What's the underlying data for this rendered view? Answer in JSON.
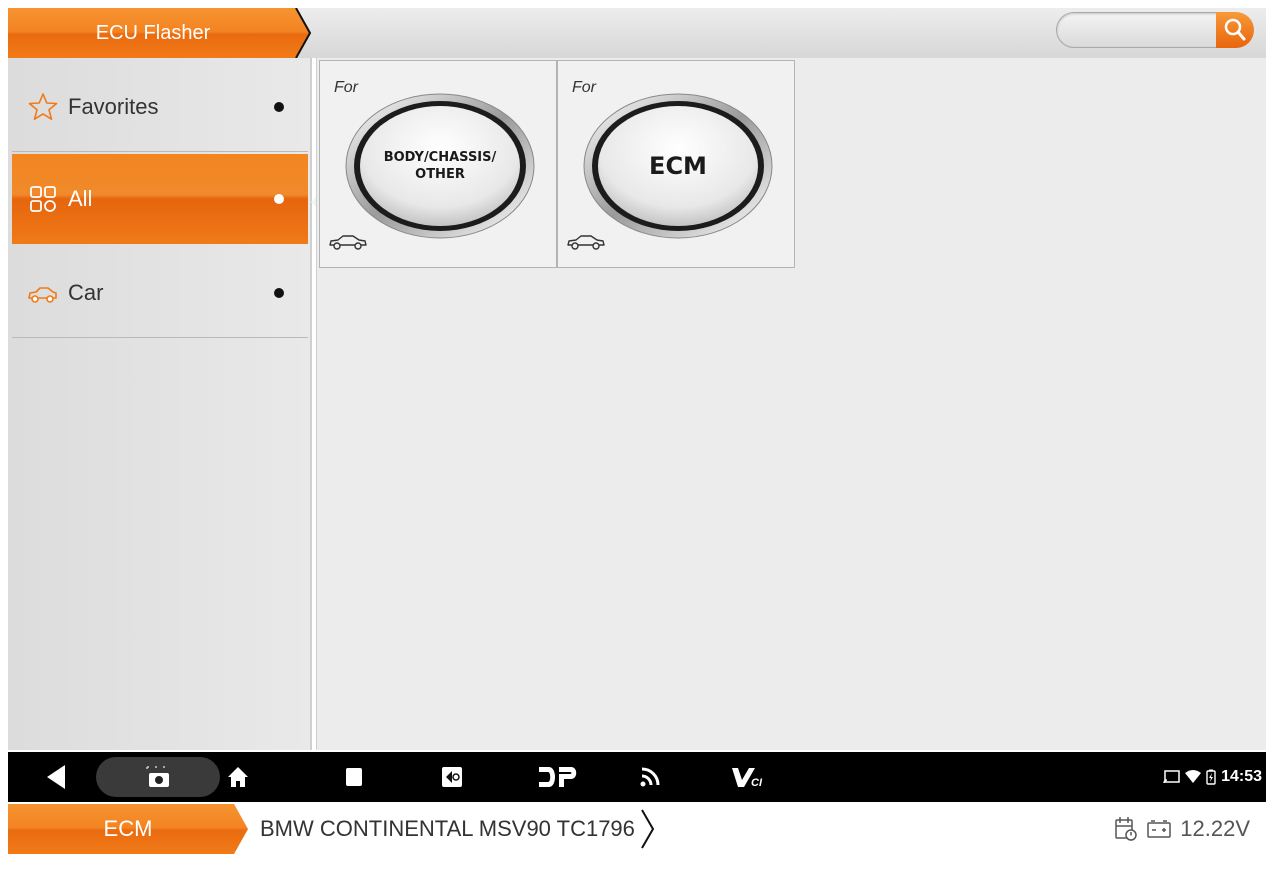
{
  "header": {
    "title": "ECU Flasher",
    "search_placeholder": ""
  },
  "sidebar": {
    "items": [
      {
        "label": "Favorites",
        "icon": "star-icon",
        "active": false
      },
      {
        "label": "All",
        "icon": "grid-icon",
        "active": true
      },
      {
        "label": "Car",
        "icon": "car-icon",
        "active": false
      }
    ]
  },
  "cards": [
    {
      "prefix": "For",
      "label_line1": "BODY/CHASSIS/",
      "label_line2": "OTHER",
      "icon": "car-icon"
    },
    {
      "prefix": "For",
      "label": "ECM",
      "icon": "car-icon"
    }
  ],
  "navbar": {
    "buttons": [
      "back-icon",
      "screenshot-icon",
      "home-icon",
      "recents-icon",
      "display-icon",
      "dp-icon",
      "wireless-icon",
      "vci-icon"
    ],
    "status_time": "14:53"
  },
  "bottom_bar": {
    "module": "ECM",
    "vehicle": "BMW CONTINENTAL MSV90 TC1796",
    "voltage": "12.22V"
  },
  "colors": {
    "accent": "#f07a18",
    "accent_dark": "#e6650d",
    "nav_bg": "#000000"
  }
}
